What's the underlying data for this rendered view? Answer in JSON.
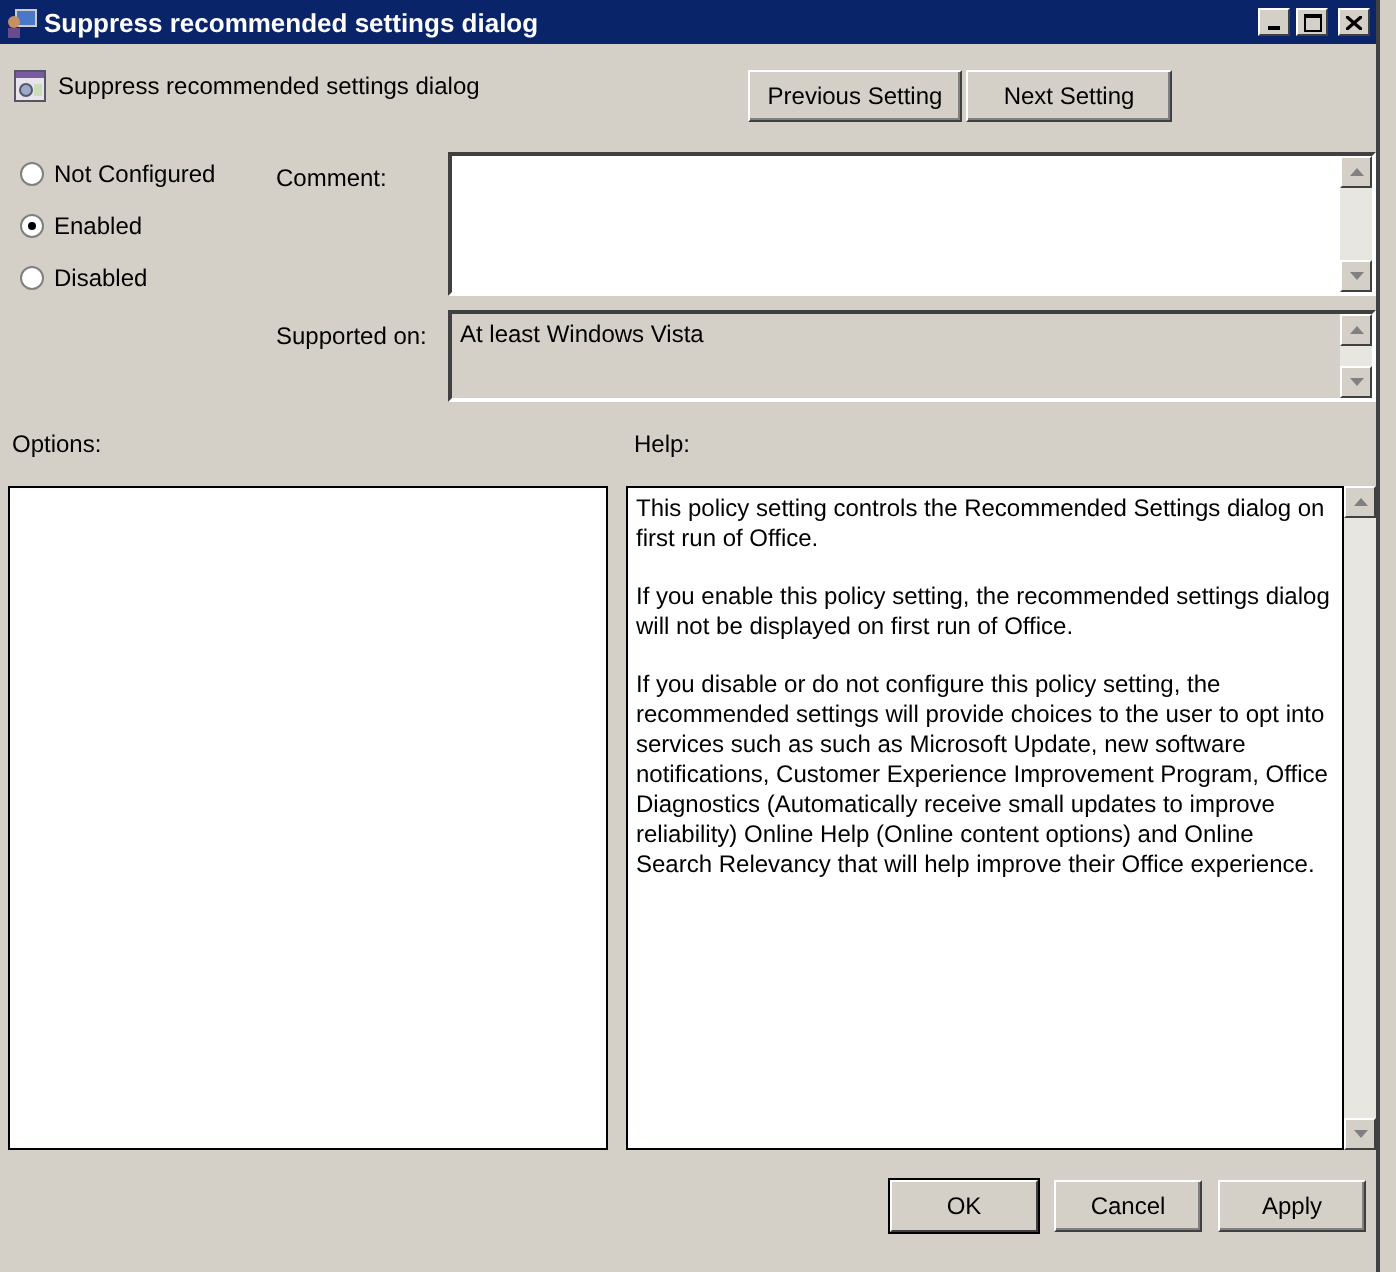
{
  "window": {
    "title": "Suppress recommended settings dialog"
  },
  "header": {
    "title": "Suppress recommended settings dialog"
  },
  "nav_buttons": [
    "Previous Setting",
    "Next Setting"
  ],
  "state_options": [
    {
      "label": "Not Configured",
      "selected": false
    },
    {
      "label": "Enabled",
      "selected": true
    },
    {
      "label": "Disabled",
      "selected": false
    }
  ],
  "comment": {
    "label": "Comment:"
  },
  "supported_on": {
    "label": "Supported on:",
    "value": "At least Windows Vista"
  },
  "options": {
    "label": "Options:"
  },
  "help": {
    "label": "Help:",
    "paragraphs": [
      "This policy setting controls the Recommended Settings dialog on first run of Office.",
      "If you enable this policy setting, the recommended settings dialog will not be displayed on first run of Office.",
      "If you disable or do not configure this policy setting, the recommended settings will provide choices to the user to opt into services such as such as Microsoft Update, new software notifications, Customer Experience Improvement Program, Office Diagnostics (Automatically receive small updates to improve reliability) Online Help (Online content options) and Online Search Relevancy that will help improve their Office experience."
    ]
  },
  "buttons": [
    {
      "label": "OK",
      "default": true
    },
    {
      "label": "Cancel",
      "default": false
    },
    {
      "label": "Apply",
      "default": false
    }
  ]
}
